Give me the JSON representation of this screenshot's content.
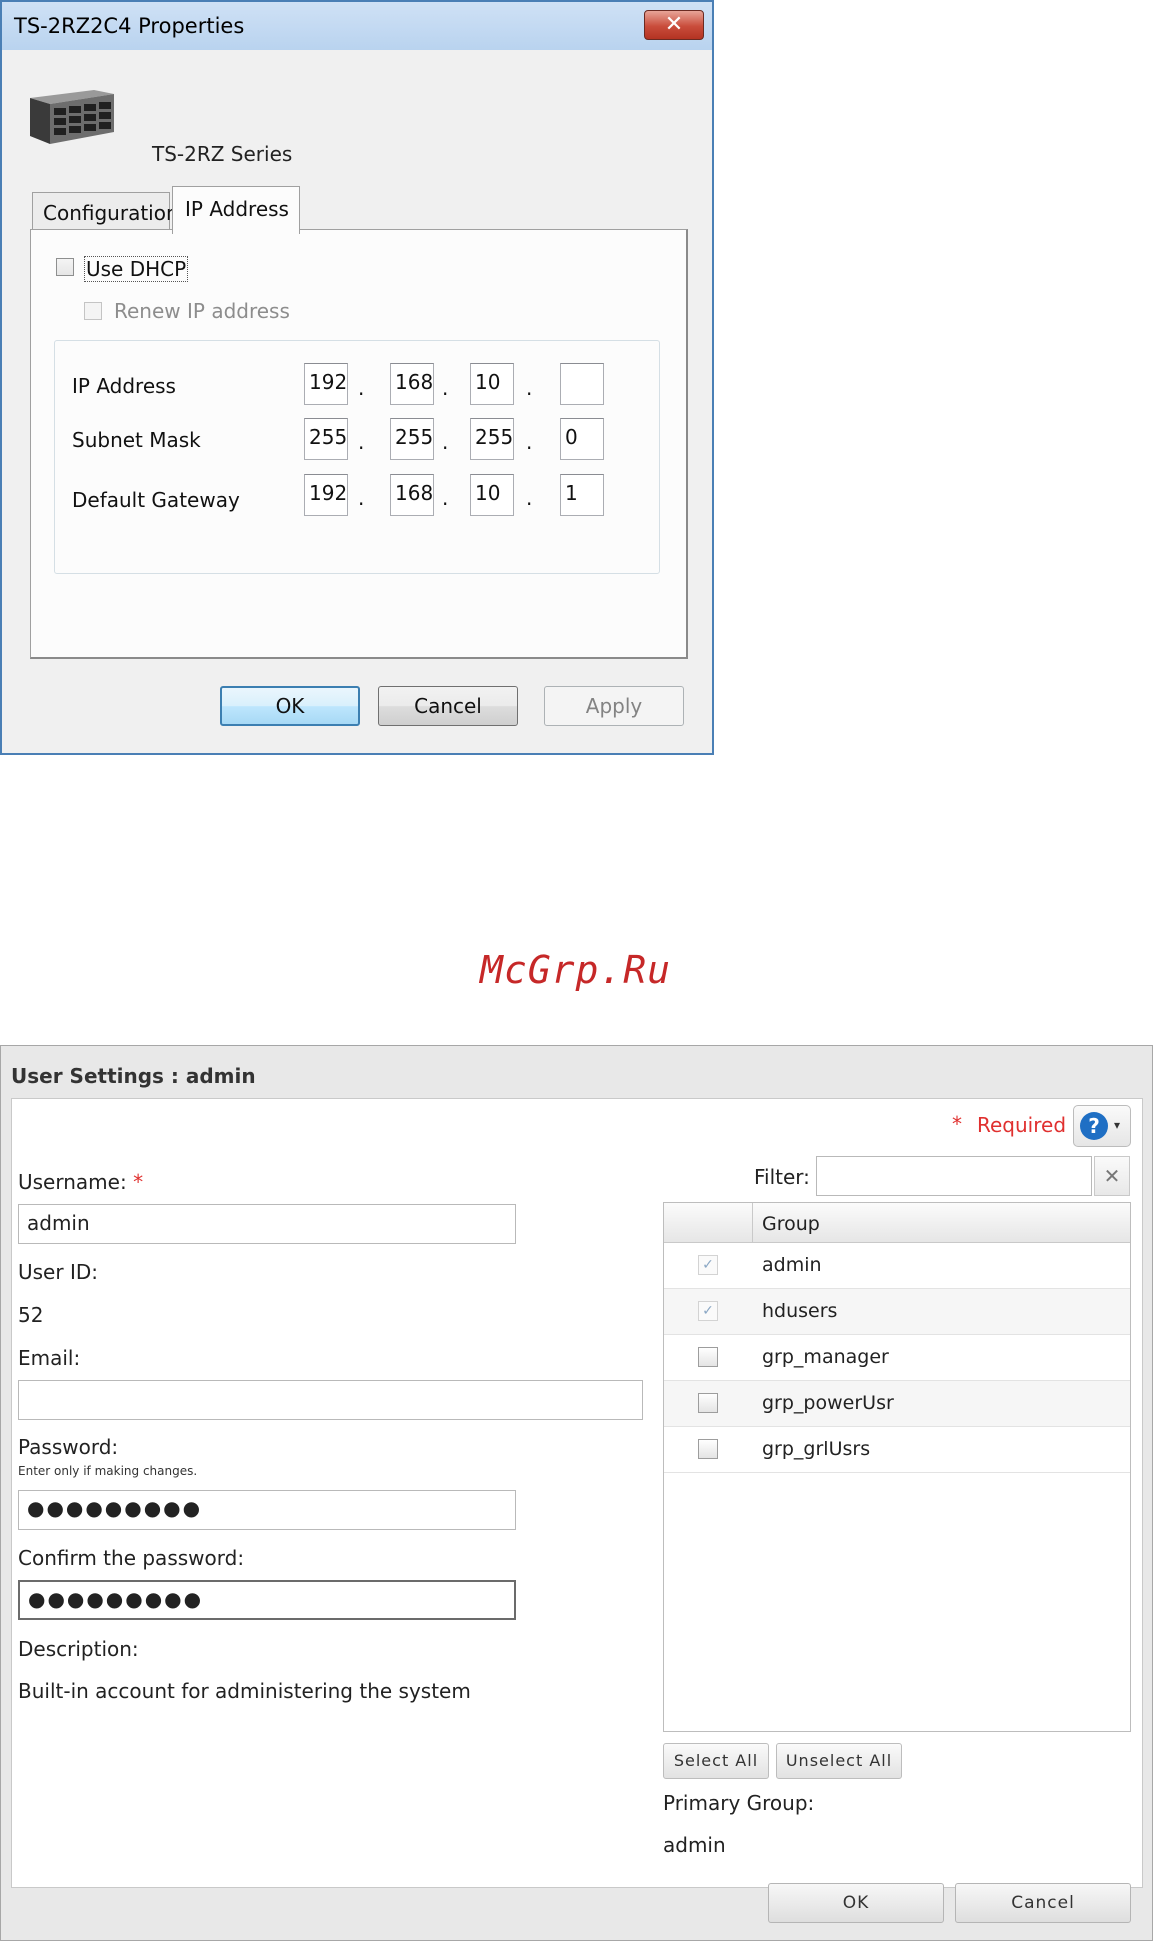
{
  "properties_dialog": {
    "title": "TS-2RZ2C4 Properties",
    "close_glyph": "✕",
    "product_name": "TS-2RZ Series",
    "tabs": [
      {
        "label": "Configuration",
        "active": false
      },
      {
        "label": "IP Address",
        "active": true
      }
    ],
    "use_dhcp": {
      "label": "Use DHCP",
      "checked": false
    },
    "renew_ip": {
      "label": "Renew IP address",
      "checked": false,
      "disabled": true
    },
    "rows": [
      {
        "label": "IP Address",
        "octets": [
          "192",
          "168",
          "10",
          ""
        ]
      },
      {
        "label": "Subnet Mask",
        "octets": [
          "255",
          "255",
          "255",
          "0"
        ]
      },
      {
        "label": "Default Gateway",
        "octets": [
          "192",
          "168",
          "10",
          "1"
        ]
      }
    ],
    "octet_separator": ".",
    "buttons": {
      "ok": "OK",
      "cancel": "Cancel",
      "apply": "Apply"
    }
  },
  "watermark": "McGrp.Ru",
  "user_settings": {
    "title": "User Settings : admin",
    "required_star": "*",
    "required_label": "Required",
    "help_glyph": "?",
    "help_caret": "▾",
    "username_label": "Username:",
    "username_value": "admin",
    "userid_label": "User ID:",
    "userid_value": "52",
    "email_label": "Email:",
    "email_value": "",
    "password_label": "Password:",
    "password_hint": "Enter only if making changes.",
    "password_value": "●●●●●●●●●",
    "confirm_label": "Confirm the password:",
    "confirm_value": "●●●●●●●●●",
    "description_label": "Description:",
    "description_value": "Built-in account for administering the system",
    "filter_label": "Filter:",
    "filter_value": "",
    "filter_clear_glyph": "✕",
    "group_column": "Group",
    "check_glyph": "✓",
    "groups": [
      {
        "name": "admin",
        "checked": true,
        "disabled": true
      },
      {
        "name": "hdusers",
        "checked": true,
        "disabled": true
      },
      {
        "name": "grp_manager",
        "checked": false,
        "disabled": false
      },
      {
        "name": "grp_powerUsr",
        "checked": false,
        "disabled": false
      },
      {
        "name": "grp_grlUsrs",
        "checked": false,
        "disabled": false
      }
    ],
    "select_all": "Select All",
    "unselect_all": "Unselect All",
    "primary_group_label": "Primary Group:",
    "primary_group_value": "admin",
    "ok": "OK",
    "cancel": "Cancel"
  }
}
